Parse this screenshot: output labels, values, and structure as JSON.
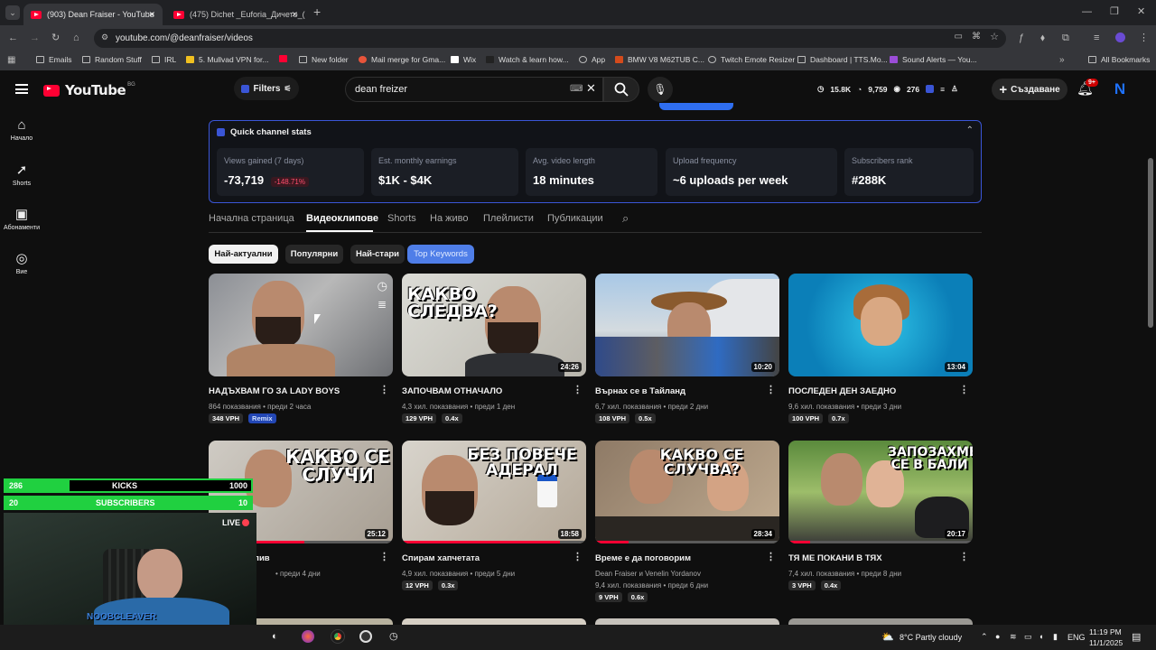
{
  "browser": {
    "tabs": [
      {
        "label": "(903) Dean Fraiser - YouTube"
      },
      {
        "label": "(475) Dichet _Euforia_Дичето_(..."
      }
    ],
    "url": "youtube.com/@deanfraiser/videos",
    "bookmarks": [
      "Emails",
      "Random Stuff",
      "IRL",
      "5. Mullvad VPN for...",
      "",
      "New folder",
      "Mail merge for Gma...",
      "Wix",
      "Watch & learn how...",
      "App",
      "BMW V8 M62TUB C...",
      "Twitch Emote Resizer",
      "Dashboard | TTS.Mo...",
      "Sound Alerts — You..."
    ],
    "all_bookmarks": "All Bookmarks"
  },
  "yt": {
    "logo": "YouTube",
    "region": "BG",
    "filters": "Filters",
    "search_value": "dean freizer",
    "header_stats": [
      "15.8K",
      "9,759",
      "276"
    ],
    "create": "Създаване",
    "notif_badge": "9+",
    "avatar": "N"
  },
  "sidebar": [
    {
      "label": "Начало",
      "icon": "home-icon"
    },
    {
      "label": "Shorts",
      "icon": "shorts-icon"
    },
    {
      "label": "Абонаменти",
      "icon": "subscriptions-icon"
    },
    {
      "label": "Вие",
      "icon": "you-icon"
    }
  ],
  "stats_panel": {
    "title": "Quick channel stats",
    "cards": [
      {
        "label": "Views gained (7 days)",
        "value": "-73,719",
        "delta": "-148.71%"
      },
      {
        "label": "Est. monthly earnings",
        "value": "$1K - $4K"
      },
      {
        "label": "Avg. video length",
        "value": "18 minutes"
      },
      {
        "label": "Upload frequency",
        "value": "~6 uploads per week"
      },
      {
        "label": "Subscribers rank",
        "value": "#288K"
      }
    ]
  },
  "channel_tabs": [
    "Начална страница",
    "Видеоклипове",
    "Shorts",
    "На живо",
    "Плейлисти",
    "Публикации"
  ],
  "chips": [
    "Най-актуални",
    "Популярни",
    "Най-стари",
    "Top Keywords"
  ],
  "videos": [
    {
      "title": "НАДЪХВАМ ГО ЗА LADY BOYS",
      "meta": "864 показвания • преди 2 часа",
      "vph": "348 VPH",
      "extra": "Remix",
      "duration": "",
      "thumb_text": ""
    },
    {
      "title": "ЗАПОЧВАМ ОТНАЧАЛО",
      "meta": "4,3 хил. показвания • преди 1 ден",
      "vph": "129 VPH",
      "extra": "0.4x",
      "duration": "24:26",
      "thumb_text": "КАКВО СЛЕДВА?"
    },
    {
      "title": "Върнах се в Тайланд",
      "meta": "6,7 хил. показвания • преди 2 дни",
      "vph": "108 VPH",
      "extra": "0.5x",
      "duration": "10:20",
      "thumb_text": ""
    },
    {
      "title": "ПОСЛЕДЕН ДЕН ЗАЕДНО",
      "meta": "9,6 хил. показвания • преди 3 дни",
      "vph": "100 VPH",
      "extra": "0.7x",
      "duration": "13:04",
      "thumb_text": ""
    },
    {
      "title": "...лив",
      "meta": "• преди 4 дни",
      "vph": "",
      "extra": "...x",
      "duration": "25:12",
      "thumb_text": "КАКВО СЕ СЛУЧИ"
    },
    {
      "title": "Спирам хапчетата",
      "meta": "4,9 хил. показвания • преди 5 дни",
      "vph": "12 VPH",
      "extra": "0.3x",
      "duration": "18:58",
      "thumb_text": "БЕЗ ПОВЕЧЕ АДЕРАЛ"
    },
    {
      "title": "Време е да поговорим",
      "meta2": "Dean Fraiser и Venelin Yordanov",
      "meta": "9,4 хил. показвания • преди 6 дни",
      "vph": "9 VPH",
      "extra": "0.6x",
      "duration": "28:34",
      "thumb_text": "КАКВО СЕ СЛУЧВА?"
    },
    {
      "title": "ТЯ МЕ ПОКАНИ В ТЯХ",
      "meta": "7,4 хил. показвания • преди 8 дни",
      "vph": "3 VPH",
      "extra": "0.4x",
      "duration": "20:17",
      "thumb_text": "ЗАПОЗАХМЕ СЕ В БАЛИ"
    }
  ],
  "overlay": {
    "kicks_count": "286",
    "kicks_label": "KICKS",
    "kicks_goal": "1000",
    "subs_count": "20",
    "subs_label": "SUBSCRIBERS",
    "subs_goal": "10",
    "live": "LIVE",
    "name": "NOOBCLEAVER"
  },
  "taskbar": {
    "weather": "8°C  Partly cloudy",
    "lang": "ENG",
    "time": "11:19 PM",
    "date": "11/1/2025"
  },
  "colors": {
    "accent": "#3ea6ff",
    "stats_border": "#3a55d6",
    "yt_red": "#ff0033",
    "overlay_green": "#20d040"
  }
}
